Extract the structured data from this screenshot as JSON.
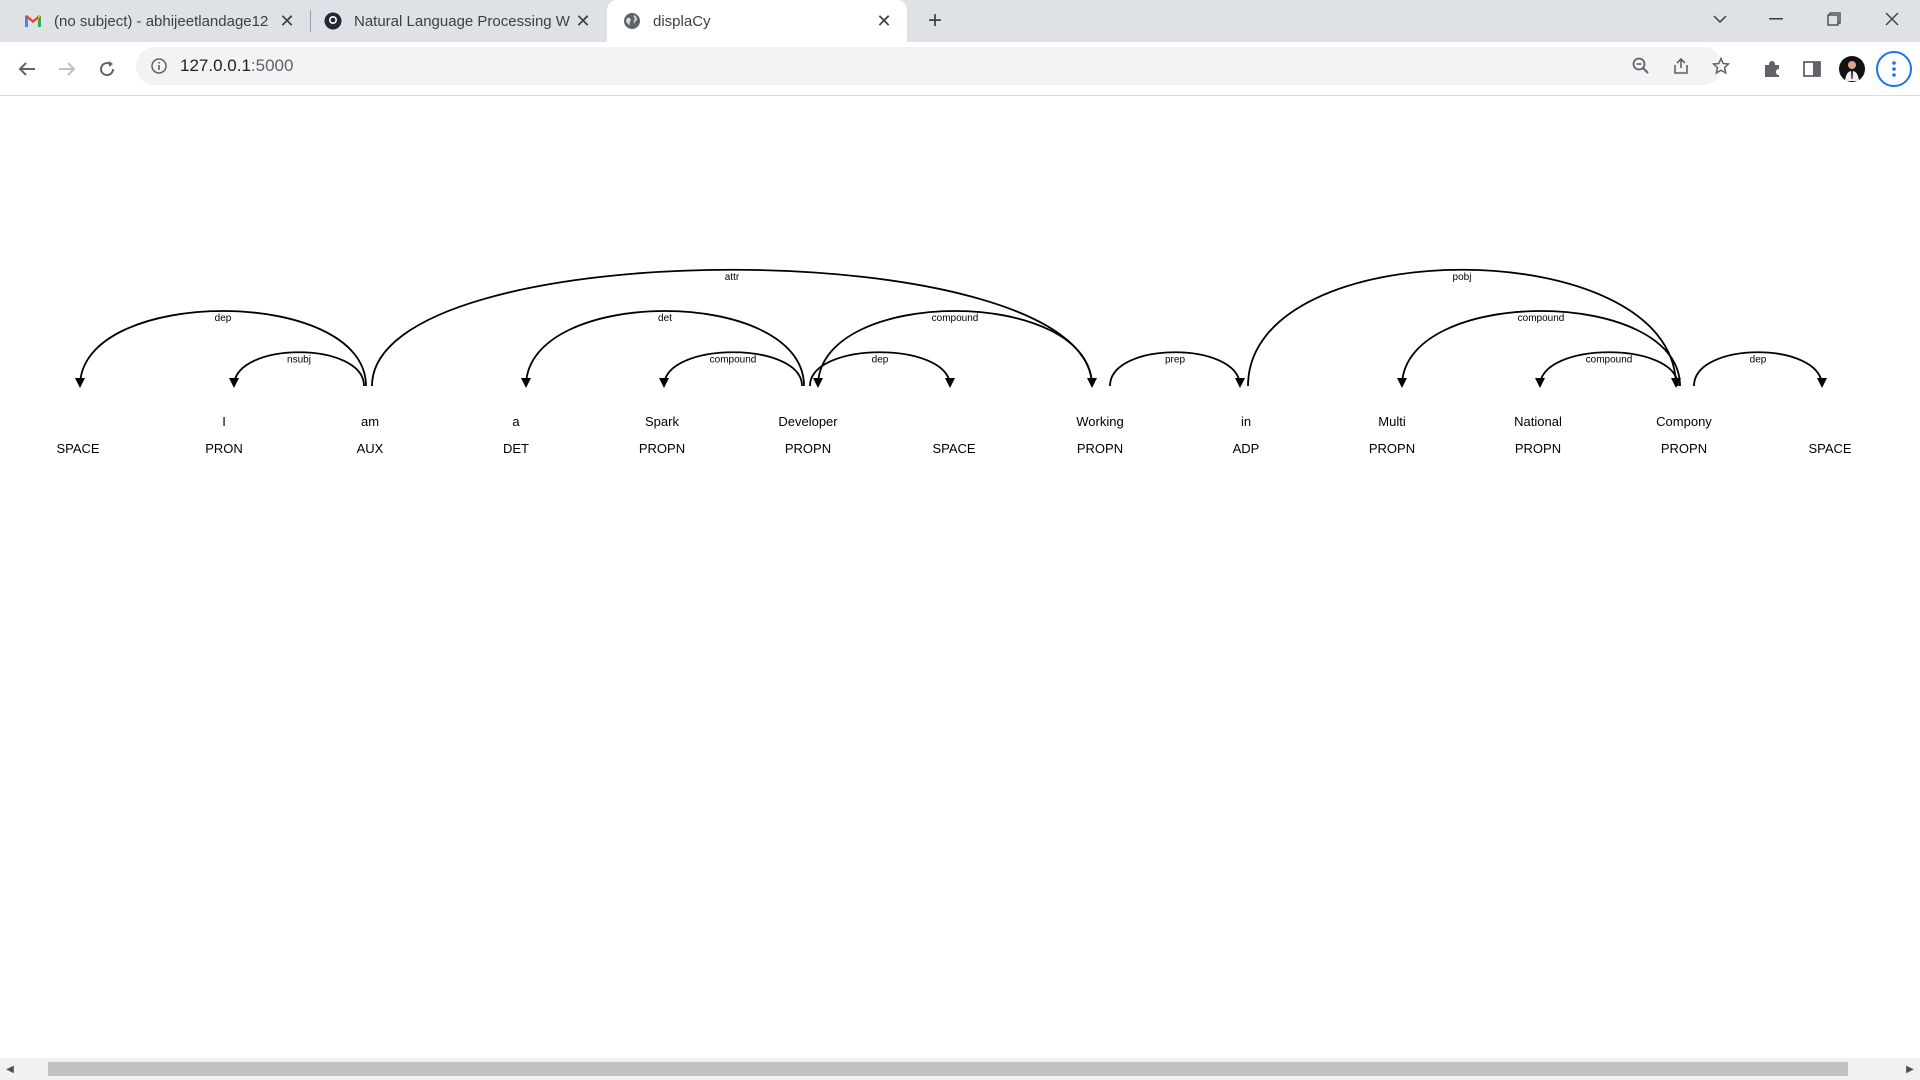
{
  "browser": {
    "tabs": [
      {
        "title": "(no subject) - abhijeetlandage12",
        "icon": "gmail-icon",
        "active": false
      },
      {
        "title": "Natural Language Processing W",
        "icon": "github-icon",
        "active": false
      },
      {
        "title": "displaCy",
        "icon": "globe-icon",
        "active": true
      }
    ],
    "url_host": "127.0.0.1",
    "url_port": ":5000"
  },
  "colors": {
    "tabstrip": "#dee1e6",
    "omnibox": "#f1f3f4",
    "arc": "#000000",
    "profile_ring": "#1a73e8"
  },
  "displacy": {
    "words": [
      {
        "text": "",
        "tag": "SPACE"
      },
      {
        "text": "I",
        "tag": "PRON"
      },
      {
        "text": "am",
        "tag": "AUX"
      },
      {
        "text": "a",
        "tag": "DET"
      },
      {
        "text": "Spark",
        "tag": "PROPN"
      },
      {
        "text": "Developer",
        "tag": "PROPN"
      },
      {
        "text": "",
        "tag": "SPACE"
      },
      {
        "text": "Working",
        "tag": "PROPN"
      },
      {
        "text": "in",
        "tag": "ADP"
      },
      {
        "text": "Multi",
        "tag": "PROPN"
      },
      {
        "text": "National",
        "tag": "PROPN"
      },
      {
        "text": "Compony",
        "tag": "PROPN"
      },
      {
        "text": "",
        "tag": "SPACE"
      }
    ],
    "arcs": [
      {
        "start": 0,
        "end": 2,
        "label": "dep",
        "dir": "left"
      },
      {
        "start": 1,
        "end": 2,
        "label": "nsubj",
        "dir": "left"
      },
      {
        "start": 2,
        "end": 7,
        "label": "attr",
        "dir": "right"
      },
      {
        "start": 3,
        "end": 5,
        "label": "det",
        "dir": "left"
      },
      {
        "start": 4,
        "end": 5,
        "label": "compound",
        "dir": "left"
      },
      {
        "start": 5,
        "end": 7,
        "label": "compound",
        "dir": "left"
      },
      {
        "start": 5,
        "end": 6,
        "label": "dep",
        "dir": "right"
      },
      {
        "start": 7,
        "end": 8,
        "label": "prep",
        "dir": "right"
      },
      {
        "start": 8,
        "end": 11,
        "label": "pobj",
        "dir": "right"
      },
      {
        "start": 9,
        "end": 11,
        "label": "compound",
        "dir": "left"
      },
      {
        "start": 10,
        "end": 11,
        "label": "compound",
        "dir": "left"
      },
      {
        "start": 11,
        "end": 12,
        "label": "dep",
        "dir": "right"
      }
    ]
  }
}
